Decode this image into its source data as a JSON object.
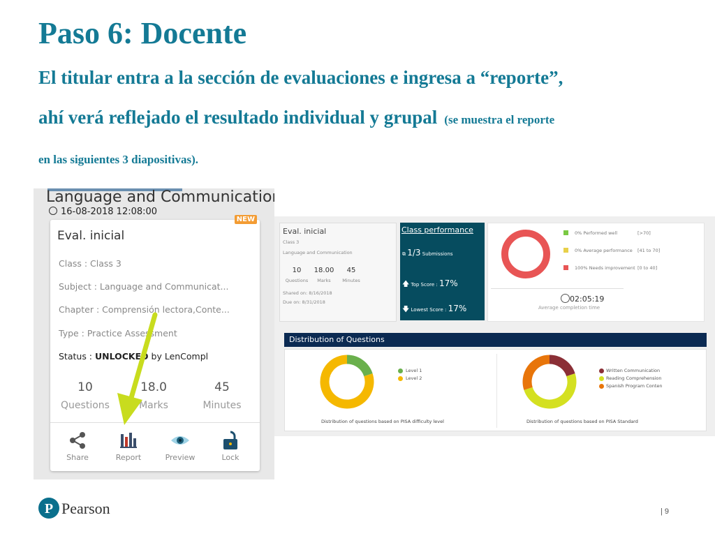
{
  "slide": {
    "title": "Paso 6: Docente",
    "subtitle_line1": "El titular entra a la sección de evaluaciones e ingresa a “reporte”,",
    "subtitle_line2": "ahí verá reflejado el resultado individual y grupal",
    "subtitle_line2_small": "(se muestra el reporte",
    "subtitle_line3": "en las siguientes 3 diapositivas).",
    "page_number": "9",
    "brand": "Pearson"
  },
  "left_card": {
    "course": "Language and Communication",
    "datetime": "16-08-2018 12:08:00",
    "badge": "NEW",
    "eval_name": "Eval. inicial",
    "class_line": "Class : Class 3",
    "subject_line": "Subject : Language and Communicat...",
    "chapter_line": "Chapter : Comprensión lectora,Conte...",
    "type_line": "Type : Practice Assessment",
    "status_prefix": "Status : ",
    "status_value": "UNLOCKED",
    "status_suffix": " by LenCompl",
    "stats": [
      {
        "value": "10",
        "label": "Questions"
      },
      {
        "value": "18.0",
        "label": "Marks"
      },
      {
        "value": "45",
        "label": "Minutes"
      }
    ],
    "actions": [
      {
        "label": "Share",
        "icon": "share-icon"
      },
      {
        "label": "Report",
        "icon": "bar-chart-icon"
      },
      {
        "label": "Preview",
        "icon": "eye-icon"
      },
      {
        "label": "Lock",
        "icon": "lock-icon"
      }
    ]
  },
  "dashboard": {
    "eval": {
      "title": "Eval. inicial",
      "class": "Class 3",
      "subject": "Language and Communication",
      "questions": "10",
      "questions_label": "Questions",
      "marks": "18.00",
      "marks_label": "Marks",
      "minutes": "45",
      "minutes_label": "Minutes",
      "shared_on": "Shared on: 8/16/2018",
      "due_on": "Due on: 8/31/2018"
    },
    "performance": {
      "title": "Class performance",
      "submissions_value": "1/3",
      "submissions_label": "Submissions",
      "top_label": "Top Score : ",
      "top_value": "17%",
      "low_label": "Lowest Score : ",
      "low_value": "17%"
    },
    "performance_chart": {
      "legend": [
        {
          "label": "0% Performed well",
          "range": "[>70]",
          "color": "#7ac943"
        },
        {
          "label": "0% Average performance",
          "range": "[41 to 70]",
          "color": "#e8d04a"
        },
        {
          "label": "100% Needs improvement",
          "range": "[0 to 40]",
          "color": "#e85555"
        }
      ],
      "values": [
        0,
        0,
        100
      ],
      "time": "02:05:19",
      "time_label": "Average completion time"
    },
    "distribution": {
      "header": "Distribution of Questions",
      "difficulty": {
        "legend": [
          {
            "label": "Level 1",
            "color": "#6ab04c"
          },
          {
            "label": "Level 2",
            "color": "#f5b800"
          }
        ],
        "values": [
          20,
          80
        ],
        "caption": "Distribution of questions based on PISA difficulty level"
      },
      "standard": {
        "legend": [
          {
            "label": "Written Communication",
            "color": "#8b2f36"
          },
          {
            "label": "Reading Comprehension",
            "color": "#d4e021"
          },
          {
            "label": "Spanish Program Conten",
            "color": "#e8750a"
          }
        ],
        "values": [
          20,
          50,
          30
        ],
        "caption": "Distribution of questions based on PISA Standard"
      }
    }
  },
  "colors": {
    "heading": "#147a95",
    "perf_panel": "#064c5f",
    "dist_header": "#0b2a52",
    "arrow": "#c8dc1e",
    "badge": "#f39c33"
  }
}
